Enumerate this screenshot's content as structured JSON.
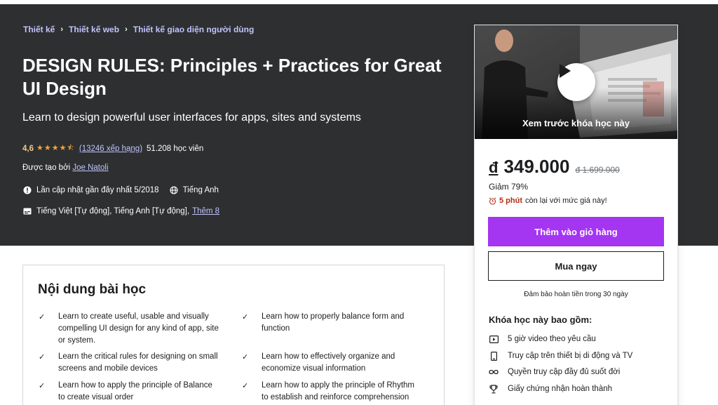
{
  "breadcrumb": [
    "Thiết kế",
    "Thiết kế web",
    "Thiết kế giao diện người dùng"
  ],
  "course": {
    "title": "DESIGN RULES: Principles + Practices for Great UI Design",
    "subtitle": "Learn to design powerful user interfaces for apps, sites and systems",
    "rating": "4,6",
    "stars": "★★★★⯪",
    "rating_count": "(13246 xếp hạng)",
    "students": "51.208 học viên",
    "created_by_label": "Được tạo bởi",
    "author": "Joe Natoli",
    "last_updated": "Lần cập nhật gần đây nhất 5/2018",
    "language": "Tiếng Anh",
    "captions": "Tiếng Việt [Tự động], Tiếng Anh [Tự động],",
    "captions_more": "Thêm 8"
  },
  "card": {
    "preview_label": "Xem trước khóa học này",
    "currency": "đ",
    "price": "349.000",
    "old_price": "đ 1.699.000",
    "discount": "Giảm 79%",
    "timer_strong": "5 phút",
    "timer_text": "còn lại với mức giá này!",
    "add_to_cart": "Thêm vào giỏ hàng",
    "buy_now": "Mua ngay",
    "guarantee": "Đảm bảo hoàn tiền trong 30 ngày",
    "includes_title": "Khóa học này bao gồm:",
    "includes": [
      {
        "icon": "video-icon",
        "text": "5 giờ video theo yêu cầu"
      },
      {
        "icon": "mobile-icon",
        "text": "Truy cập trên thiết bị di động và TV"
      },
      {
        "icon": "infinity-icon",
        "text": "Quyền truy cập đầy đủ suốt đời"
      },
      {
        "icon": "trophy-icon",
        "text": "Giấy chứng nhận hoàn thành"
      }
    ]
  },
  "learn": {
    "title": "Nội dung bài học",
    "items": [
      {
        "l1": "Learn to create useful, usable and visually",
        "l2": "compelling UI design for any kind of app, site",
        "l3": "or system."
      },
      {
        "l1": "Learn how to properly balance form and",
        "l2": "function"
      },
      {
        "l1": "Learn the critical rules for designing on small",
        "l2": "screens and mobile devices"
      },
      {
        "l1": "Learn how to effectively organize and",
        "l2": "economize visual information"
      },
      {
        "l1": "Learn how to apply the principle of Balance",
        "l2": "to create visual order"
      },
      {
        "l1": "Learn how to apply the principle of Rhythm",
        "l2": "to establish and reinforce comprehension"
      }
    ]
  },
  "colors": {
    "hero_bg": "#2d2f31",
    "link": "#c0c4fc",
    "accent": "#a435f0",
    "rating": "#f3ca8c",
    "timer": "#b32d0f"
  }
}
